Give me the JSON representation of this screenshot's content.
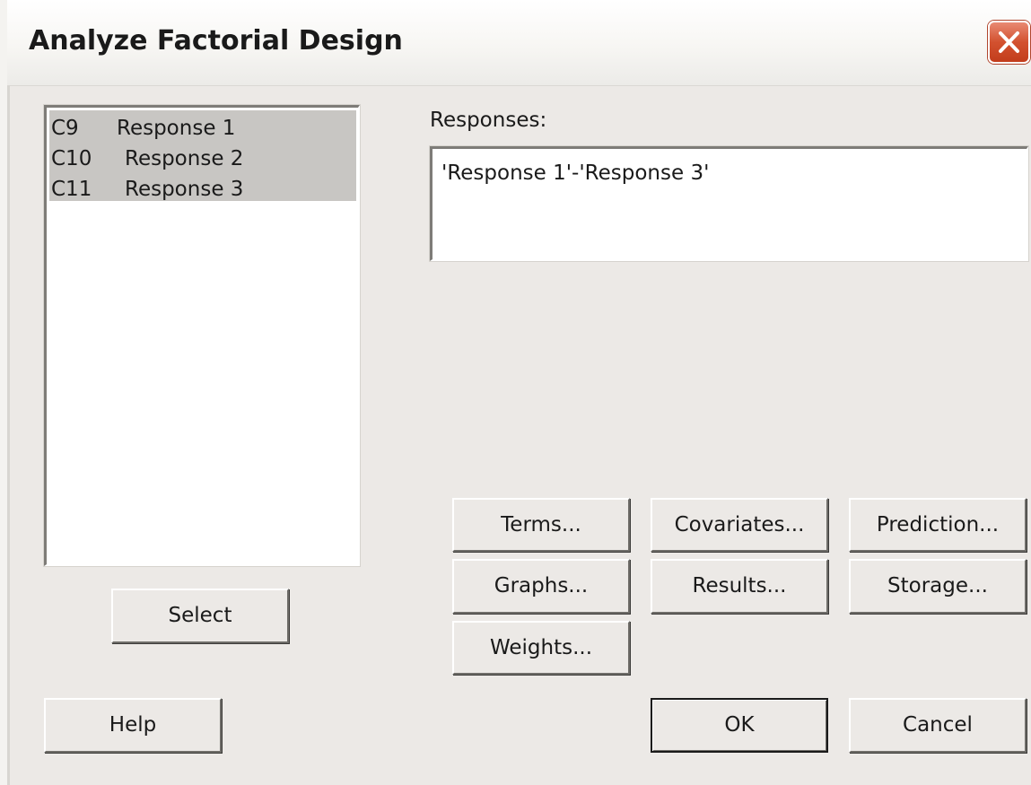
{
  "window": {
    "title": "Analyze Factorial Design",
    "close_icon": "close-x-icon"
  },
  "columns_list": {
    "items": [
      {
        "column": "C9",
        "name": "Response 1",
        "selected": true
      },
      {
        "column": "C10",
        "name": "Response 2",
        "selected": true
      },
      {
        "column": "C11",
        "name": "Response 3",
        "selected": true
      }
    ]
  },
  "responses": {
    "label": "Responses:",
    "value": "'Response 1'-'Response 3'"
  },
  "buttons": {
    "select": "Select",
    "terms": "Terms...",
    "covariates": "Covariates...",
    "prediction": "Prediction...",
    "graphs": "Graphs...",
    "results": "Results...",
    "storage": "Storage...",
    "weights": "Weights...",
    "help": "Help",
    "ok": "OK",
    "cancel": "Cancel"
  },
  "colors": {
    "dialog_bg": "#ece9e6",
    "selection_bg": "#c8c6c3",
    "close_button": "#d3512f"
  }
}
